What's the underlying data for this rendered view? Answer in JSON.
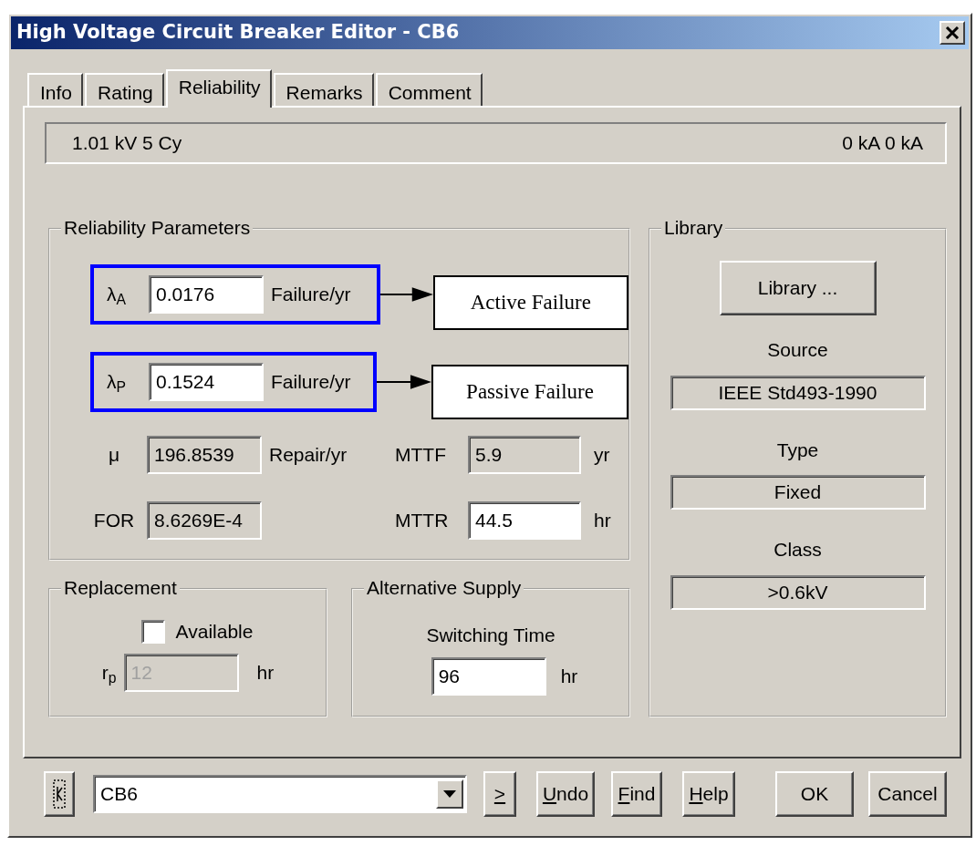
{
  "window": {
    "title": "High Voltage Circuit Breaker Editor - CB6"
  },
  "tabs": [
    {
      "label": "Info",
      "selected": false
    },
    {
      "label": "Rating",
      "selected": false
    },
    {
      "label": "Reliability",
      "selected": true
    },
    {
      "label": "Remarks",
      "selected": false
    },
    {
      "label": "Comment",
      "selected": false
    }
  ],
  "summary": {
    "left": "1.01 kV  5 Cy",
    "right": "0 kA  0 kA"
  },
  "reliability": {
    "title": "Reliability Parameters",
    "failure_rates": [
      {
        "symbol": "λ$_{A}$",
        "value": "0.0176",
        "unit": "Failure/yr",
        "callout": "Active Failure"
      },
      {
        "symbol": "λ$_{P}$",
        "value": "0.1524",
        "unit": "Failure/yr",
        "callout": "Passive Failure"
      }
    ],
    "fields": [
      {
        "label": "μ",
        "value": "196.8539",
        "unit": "Repair/yr",
        "editable": false
      },
      {
        "label": "MTTF",
        "value": "5.9",
        "unit": "yr",
        "editable": false
      },
      {
        "label": "FOR",
        "value": "8.6269E-4",
        "editable": false
      },
      {
        "label": "MTTR",
        "value": "44.5",
        "unit": "hr",
        "editable": true
      }
    ]
  },
  "replacement": {
    "title": "Replacement",
    "available": {
      "label": "Available",
      "checked": false
    },
    "repair_time": {
      "label": "r$_{p}$",
      "value": "12",
      "unit": "hr",
      "disabled": true
    }
  },
  "alternative_supply": {
    "title": "Alternative Supply",
    "label": "Switching Time",
    "value": "96",
    "unit": "hr"
  },
  "library": {
    "title": "Library",
    "button": "Library ...",
    "fields": [
      {
        "label": "Source",
        "value": "IEEE Std493-1990"
      },
      {
        "label": "Type",
        "value": "Fixed"
      },
      {
        "label": "Class",
        "value": ">0.6kV"
      }
    ]
  },
  "footer": {
    "selector": "CB6",
    "buttons": [
      {
        "label": ">",
        "underline_first": true
      },
      {
        "label": "Undo",
        "underline_first": true
      },
      {
        "label": "Find",
        "underline_first": true
      },
      {
        "label": "Help",
        "underline_first": true
      },
      {
        "label": "OK",
        "underline_first": false
      },
      {
        "label": "Cancel",
        "underline_first": false
      }
    ]
  }
}
